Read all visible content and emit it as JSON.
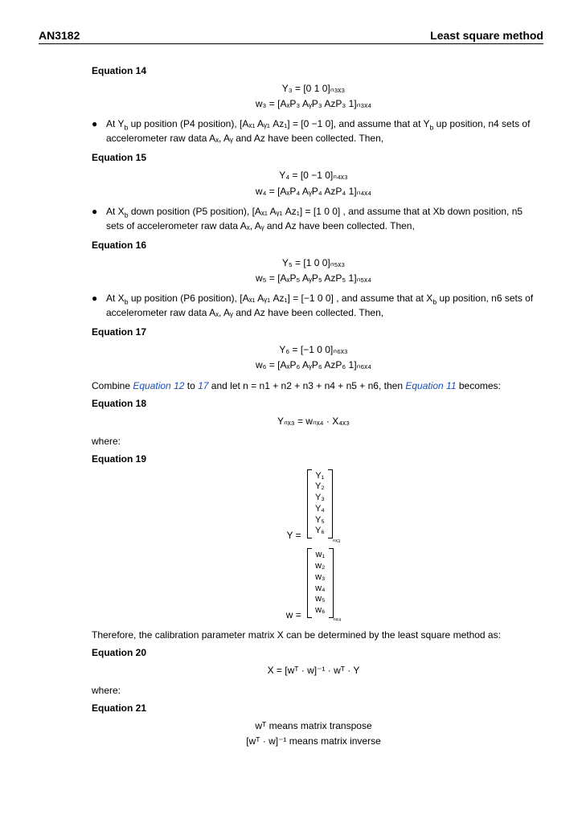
{
  "header": {
    "doc_id": "AN3182",
    "section_title": "Least square method"
  },
  "eq14": {
    "title": "Equation 14",
    "line1": "Y₃ = [0   1   0]ₙ₃ₓ₃",
    "line2": "w₃ = [AₓP₃   AᵧP₃   AᴢP₃   1]ₙ₃ₓ₄"
  },
  "bullet14": {
    "part1": "At Y",
    "part2": " up position (P4 position), [Aₓ₁   Aᵧ₁   Aᴢ₁] = [0   −1   0], and assume that at Y",
    "part3": " up position, n4 sets of accelerometer raw data Aₓ, Aᵧ and Aᴢ have been collected. Then,"
  },
  "eq15": {
    "title": "Equation 15",
    "line1": "Y₄ = [0   −1   0]ₙ₄ₓ₃",
    "line2": "w₄ = [AₓP₄   AᵧP₄   AᴢP₄   1]ₙ₄ₓ₄"
  },
  "bullet15": {
    "part1": "At X",
    "part2": " down position (P5 position), [Aₓ₁   Aᵧ₁   Aᴢ₁] = [1   0   0] , and assume that at Xb down position, n5 sets of accelerometer raw data Aₓ, Aᵧ and Aᴢ have been collected. Then,"
  },
  "eq16": {
    "title": "Equation 16",
    "line1": "Y₅ = [1   0   0]ₙ₅ₓ₃",
    "line2": "w₅ = [AₓP₅   AᵧP₅   AᴢP₅   1]ₙ₅ₓ₄"
  },
  "bullet16": {
    "part1": "At X",
    "part2": " up position (P6 position), [Aₓ₁   Aᵧ₁   Aᴢ₁] = [−1   0   0] , and assume that at X",
    "part3": " up position, n6 sets of accelerometer raw data Aₓ, Aᵧ and Aᴢ have been collected. Then,"
  },
  "eq17": {
    "title": "Equation 17",
    "line1": "Y₆ = [−1   0   0]ₙ₆ₓ₃",
    "line2": "w₆ = [AₓP₆   AᵧP₆   AᴢP₆   1]ₙ₆ₓ₄"
  },
  "combine": {
    "pre": "Combine ",
    "link1": "Equation 12",
    "mid1": " to ",
    "link2": "17",
    "mid2": " and let n = n1 + n2 + n3 + n4 + n5 + n6, then ",
    "link3": "Equation 11",
    "post": " becomes:"
  },
  "eq18": {
    "title": "Equation 18",
    "line1": "Yₙₓ₃ = wₙₓ₄ · X₄ₓ₃"
  },
  "where": "where:",
  "eq19": {
    "title": "Equation 19",
    "Y_label": "Y =",
    "Y_rows": [
      "Y₁",
      "Y₂",
      "Y₃",
      "Y₄",
      "Y₅",
      "Y₆"
    ],
    "Y_sub": "ₙₓ₃",
    "W_label": "w =",
    "W_rows": [
      "w₁",
      "w₂",
      "w₃",
      "w₄",
      "w₅",
      "w₆"
    ],
    "W_sub": "ₙₓ₄"
  },
  "therefore": "Therefore, the calibration parameter matrix X can be determined by the least square method as:",
  "eq20": {
    "title": "Equation 20",
    "line1": "X = [wᵀ · w]⁻¹ · wᵀ · Y"
  },
  "where2": "where:",
  "eq21": {
    "title": "Equation 21",
    "line1": "wᵀ   means matrix transpose",
    "line2": "[wᵀ · w]⁻¹  means matrix inverse"
  }
}
